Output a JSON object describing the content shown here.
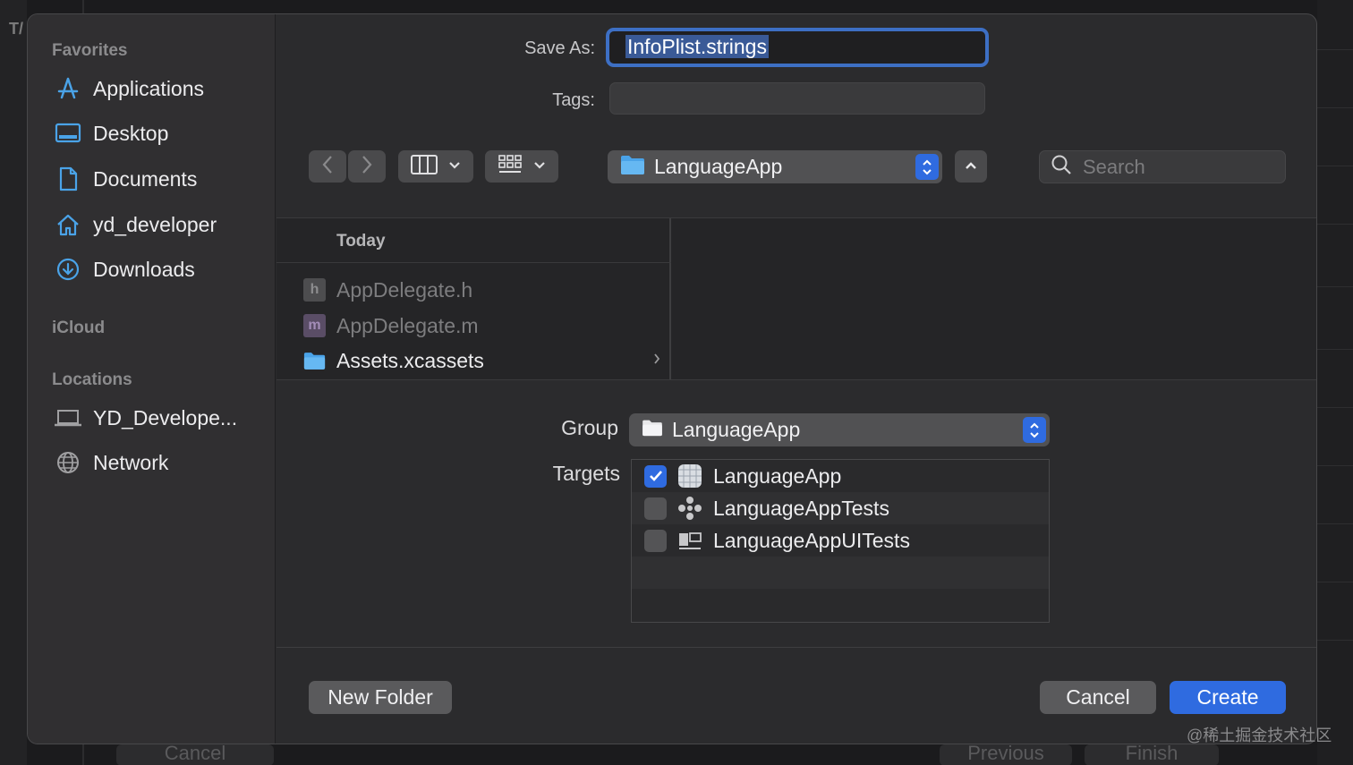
{
  "background": {
    "left_letter": "T/",
    "bottom_buttons": [
      "Cancel",
      "Previous",
      "Finish"
    ]
  },
  "sidebar": {
    "favorites_header": "Favorites",
    "favorites": [
      {
        "label": "Applications",
        "icon": "applications-icon"
      },
      {
        "label": "Desktop",
        "icon": "desktop-icon"
      },
      {
        "label": "Documents",
        "icon": "documents-icon"
      },
      {
        "label": "yd_developer",
        "icon": "home-icon"
      },
      {
        "label": "Downloads",
        "icon": "downloads-icon"
      }
    ],
    "icloud_header": "iCloud",
    "locations_header": "Locations",
    "locations": [
      {
        "label": "YD_Develope...",
        "icon": "laptop-icon"
      },
      {
        "label": "Network",
        "icon": "network-icon"
      }
    ]
  },
  "form": {
    "save_as_label": "Save As:",
    "save_as_value": "InfoPlist.strings",
    "tags_label": "Tags:",
    "tags_value": ""
  },
  "toolbar": {
    "path": "LanguageApp",
    "search_placeholder": "Search"
  },
  "browser": {
    "section_header": "Today",
    "files": [
      {
        "name": "AppDelegate.h",
        "icon": "h-file-icon",
        "dimmed": true
      },
      {
        "name": "AppDelegate.m",
        "icon": "m-file-icon",
        "dimmed": true
      },
      {
        "name": "Assets.xcassets",
        "icon": "folder-icon",
        "dimmed": false
      }
    ]
  },
  "options": {
    "group_label": "Group",
    "group_value": "LanguageApp",
    "targets_label": "Targets",
    "targets": [
      {
        "name": "LanguageApp",
        "checked": true,
        "icon": "app-target-icon"
      },
      {
        "name": "LanguageAppTests",
        "checked": false,
        "icon": "tests-target-icon"
      },
      {
        "name": "LanguageAppUITests",
        "checked": false,
        "icon": "uitests-target-icon"
      }
    ]
  },
  "footer": {
    "new_folder": "New Folder",
    "cancel": "Cancel",
    "create": "Create"
  },
  "watermark": "@稀土掘金技术社区",
  "colors": {
    "accent": "#2f6be0",
    "dialog_bg": "#2b2b2d",
    "sidebar_bg": "#302f31",
    "folder_blue": "#4aa3e8"
  }
}
